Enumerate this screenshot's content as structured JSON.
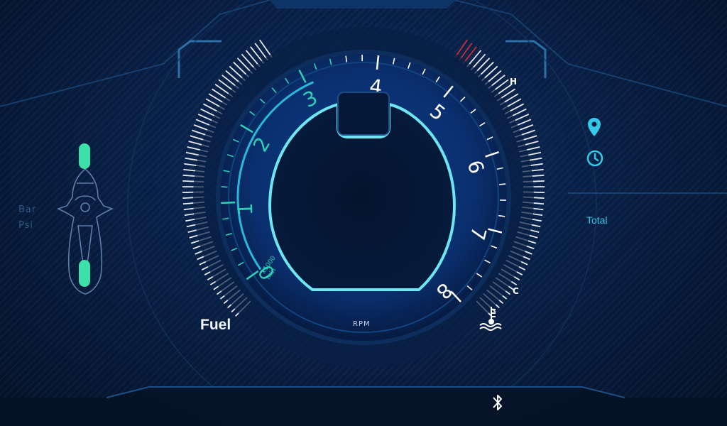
{
  "tire_pressure": {
    "unit_primary": "Bar",
    "unit_secondary": "Psi"
  },
  "fuel": {
    "label": "Fuel"
  },
  "tachometer": {
    "label": "RPM",
    "unit_line1": "x1000",
    "unit_line2": "min",
    "scale_labels": [
      "0",
      "1",
      "2",
      "3",
      "4",
      "5",
      "6",
      "7",
      "8"
    ]
  },
  "temperature": {
    "high_label": "H",
    "low_label": "C"
  },
  "trip": {
    "total_label": "Total"
  },
  "icons": {
    "motorcycle": "motorcycle-topview-icon",
    "location": "map-pin-icon",
    "clock": "clock-icon",
    "coolant": "coolant-temperature-icon",
    "bluetooth": "bluetooth-icon"
  },
  "colors": {
    "accent": "#35d0ee",
    "tire_indicator": "#3ce0a8",
    "scale_low": "#2fd0b8",
    "scale_high": "#ffffff",
    "temp_warning": "#e0303a"
  }
}
